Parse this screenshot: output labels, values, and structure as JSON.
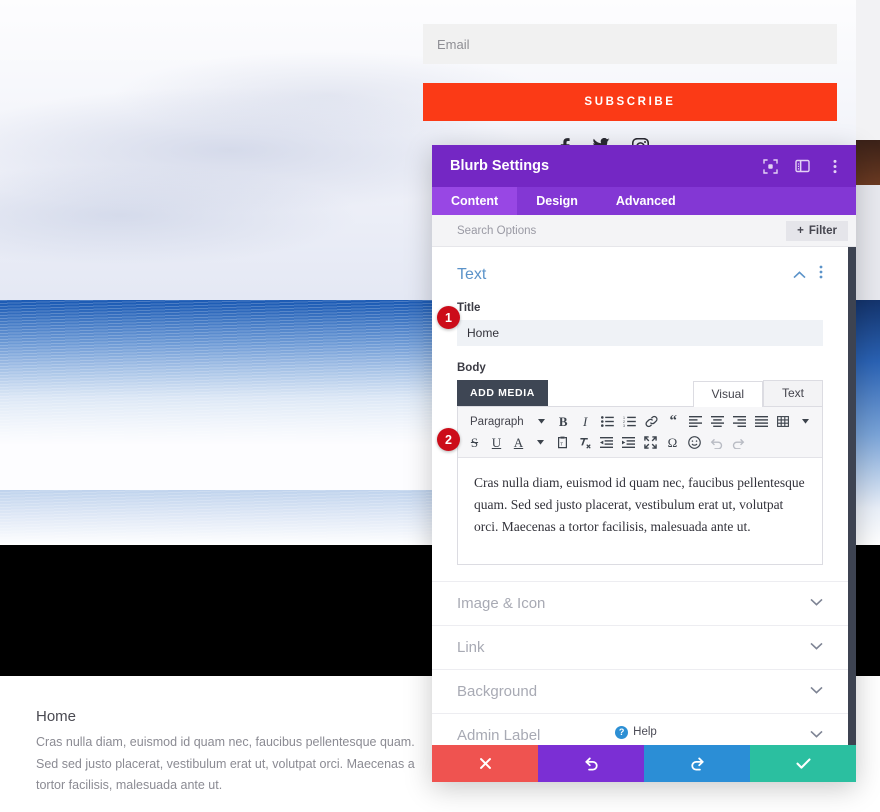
{
  "subscribe": {
    "email_placeholder": "Email",
    "email_value": "",
    "button_label": "SUBSCRIBE",
    "social_icons": [
      "facebook-icon",
      "twitter-icon",
      "instagram-icon"
    ]
  },
  "page_preview": {
    "heading": "Home",
    "body": "Cras nulla diam, euismod id quam nec, faucibus pellentesque quam. Sed sed justo placerat, vestibulum erat ut, volutpat orci. Maecenas a tortor facilisis, malesuada ante ut."
  },
  "modal": {
    "title": "Blurb Settings",
    "header_icons": [
      "fullscreen-icon",
      "panel-layout-icon",
      "more-options-icon"
    ],
    "tabs": [
      {
        "label": "Content",
        "active": true
      },
      {
        "label": "Design",
        "active": false
      },
      {
        "label": "Advanced",
        "active": false
      }
    ],
    "search": {
      "placeholder": "Search Options",
      "value": "",
      "filter_label": "Filter",
      "filter_icon": "plus-icon"
    },
    "text_section": {
      "title": "Text",
      "collapse_icon": "chevron-up-icon",
      "options_icon": "more-options-icon",
      "title_field": {
        "label": "Title",
        "value": "Home"
      },
      "body_field": {
        "label": "Body",
        "add_media_label": "ADD MEDIA",
        "editor_tabs": [
          {
            "label": "Visual",
            "active": true
          },
          {
            "label": "Text",
            "active": false
          }
        ],
        "toolbar_row1": [
          {
            "name": "paragraph-format-select",
            "label": "Paragraph"
          },
          {
            "name": "bold-button",
            "glyph": "B"
          },
          {
            "name": "italic-button",
            "glyph": "I"
          },
          {
            "name": "bulleted-list-button",
            "glyph": "list-ul"
          },
          {
            "name": "numbered-list-button",
            "glyph": "list-ol"
          },
          {
            "name": "insert-link-button",
            "glyph": "link"
          },
          {
            "name": "blockquote-button",
            "glyph": "quote"
          },
          {
            "name": "align-left-button",
            "glyph": "align-left"
          },
          {
            "name": "align-center-button",
            "glyph": "align-center"
          },
          {
            "name": "align-right-button",
            "glyph": "align-right"
          },
          {
            "name": "align-justify-button",
            "glyph": "align-justify"
          },
          {
            "name": "insert-table-button",
            "glyph": "table"
          }
        ],
        "toolbar_row2": [
          {
            "name": "strikethrough-button",
            "glyph": "S"
          },
          {
            "name": "underline-button",
            "glyph": "U"
          },
          {
            "name": "text-color-button",
            "glyph": "A"
          },
          {
            "name": "paste-as-text-button",
            "glyph": "clipboard"
          },
          {
            "name": "clear-formatting-button",
            "glyph": "eraser"
          },
          {
            "name": "outdent-button",
            "glyph": "outdent"
          },
          {
            "name": "indent-button",
            "glyph": "indent"
          },
          {
            "name": "fullscreen-button",
            "glyph": "expand"
          },
          {
            "name": "special-character-button",
            "glyph": "omega"
          },
          {
            "name": "emoticon-button",
            "glyph": "smiley"
          },
          {
            "name": "undo-button",
            "glyph": "undo"
          },
          {
            "name": "redo-button",
            "glyph": "redo"
          }
        ],
        "content": "Cras nulla diam, euismod id quam nec, faucibus pellentesque quam. Sed sed justo placerat, vestibulum erat ut, volutpat orci. Maecenas a tortor facilisis, malesuada ante ut."
      }
    },
    "collapsed_sections": [
      {
        "label": "Image & Icon"
      },
      {
        "label": "Link"
      },
      {
        "label": "Background"
      },
      {
        "label": "Admin Label"
      }
    ],
    "help": {
      "label": "Help",
      "icon": "question-mark-icon"
    },
    "footer_buttons": [
      {
        "name": "cancel-button",
        "icon": "close-icon",
        "color": "#ef5350"
      },
      {
        "name": "undo-button",
        "icon": "undo-icon",
        "color": "#7b2fd4"
      },
      {
        "name": "redo-button",
        "icon": "redo-icon",
        "color": "#2b8ed6"
      },
      {
        "name": "save-button",
        "icon": "check-icon",
        "color": "#2bbfa0"
      }
    ]
  },
  "annotations": [
    {
      "number": "1",
      "target": "title-input"
    },
    {
      "number": "2",
      "target": "body-editor"
    }
  ]
}
